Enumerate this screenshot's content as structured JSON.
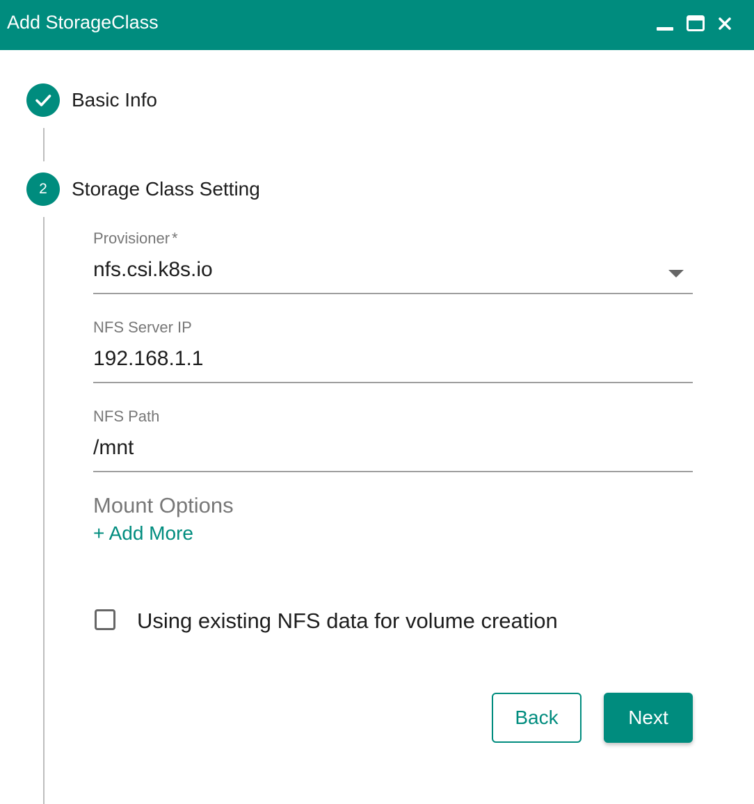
{
  "window": {
    "title": "Add StorageClass",
    "controls": [
      "minimize-icon",
      "maximize-icon",
      "close-icon"
    ],
    "accent_color": "#008c7e"
  },
  "steps": [
    {
      "label": "Basic Info",
      "status": "completed",
      "icon": "check-icon"
    },
    {
      "label": "Storage Class Setting",
      "status": "active",
      "number": "2"
    }
  ],
  "form": {
    "provisioner": {
      "label": "Provisioner",
      "required_mark": "*",
      "value": "nfs.csi.k8s.io"
    },
    "nfs_server_ip": {
      "label": "NFS Server IP",
      "value": "192.168.1.1"
    },
    "nfs_path": {
      "label": "NFS Path",
      "value": "/mnt"
    },
    "mount_options": {
      "label": "Mount Options",
      "add_more_label": "+ Add More"
    },
    "existing_data": {
      "label": "Using existing NFS data for volume creation",
      "checked": false
    }
  },
  "actions": {
    "back_label": "Back",
    "next_label": "Next"
  }
}
